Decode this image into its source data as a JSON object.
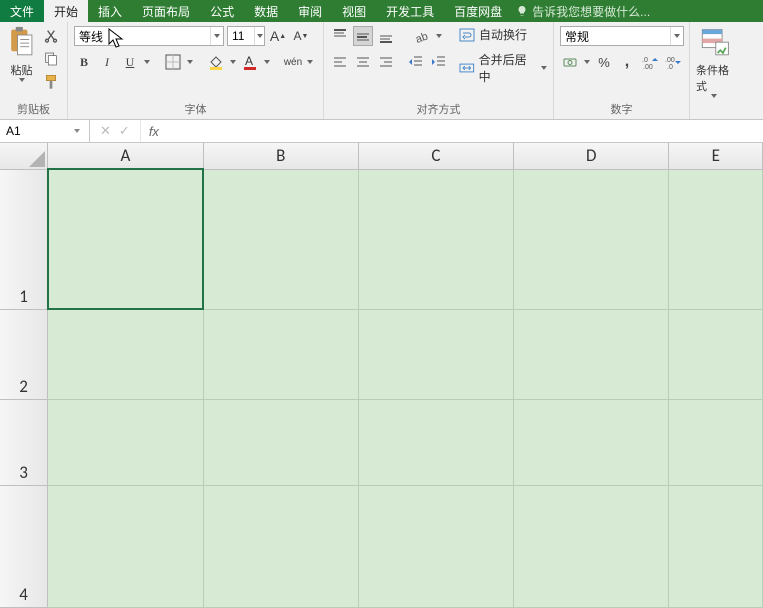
{
  "menubar": {
    "file": "文件",
    "tabs": [
      "开始",
      "插入",
      "页面布局",
      "公式",
      "数据",
      "审阅",
      "视图",
      "开发工具",
      "百度网盘"
    ],
    "active_index": 0,
    "tell_me": "告诉我您想要做什么..."
  },
  "ribbon": {
    "clipboard": {
      "paste": "粘贴",
      "label": "剪贴板"
    },
    "font": {
      "name": "等线",
      "size": "11",
      "bold": "B",
      "italic": "I",
      "underline": "U",
      "pinyin": "wén",
      "incA": "A",
      "decA": "A",
      "label": "字体"
    },
    "alignment": {
      "wrap": "自动换行",
      "merge": "合并后居中",
      "label": "对齐方式"
    },
    "number": {
      "format": "常规",
      "percent": "%",
      "label": "数字"
    },
    "styles": {
      "cond": "条件格式",
      "label": ""
    }
  },
  "namebox": {
    "value": "A1"
  },
  "formula_bar": {
    "fx": "fx",
    "value": ""
  },
  "grid": {
    "cols": [
      "A",
      "B",
      "C",
      "D",
      "E"
    ],
    "rows": [
      "1",
      "2",
      "3",
      "4"
    ],
    "active": "A1"
  }
}
